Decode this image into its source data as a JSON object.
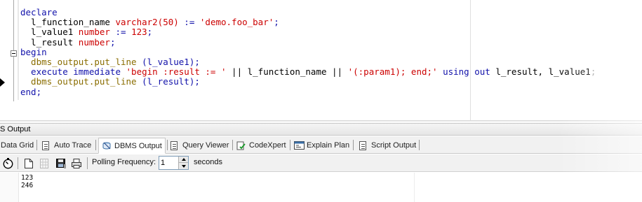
{
  "editor": {
    "lines": [
      [
        {
          "t": "declare",
          "c": "kw"
        }
      ],
      [
        {
          "t": "  l_function_name ",
          "c": "pl"
        },
        {
          "t": "varchar2(50)",
          "c": "ty"
        },
        {
          "t": " := ",
          "c": "kw"
        },
        {
          "t": "'demo.foo_bar'",
          "c": "st"
        },
        {
          "t": ";",
          "c": "kw"
        }
      ],
      [
        {
          "t": "  l_value1 ",
          "c": "pl"
        },
        {
          "t": "number",
          "c": "ty"
        },
        {
          "t": " := ",
          "c": "kw"
        },
        {
          "t": "123",
          "c": "st"
        },
        {
          "t": ";",
          "c": "kw"
        }
      ],
      [
        {
          "t": "  l_result ",
          "c": "pl"
        },
        {
          "t": "number",
          "c": "ty"
        },
        {
          "t": ";",
          "c": "kw"
        }
      ],
      [
        {
          "t": "begin",
          "c": "kw"
        }
      ],
      [
        {
          "t": "  dbms_output.put_line ",
          "c": "fn"
        },
        {
          "t": "(l_value1);",
          "c": "kw"
        }
      ],
      [
        {
          "t": "  execute immediate ",
          "c": "kw"
        },
        {
          "t": "'begin :result := '",
          "c": "st"
        },
        {
          "t": " || l_function_name || ",
          "c": "pl"
        },
        {
          "t": "'(:param1); end;'",
          "c": "st"
        },
        {
          "t": " using out ",
          "c": "kw"
        },
        {
          "t": "l_result, l_value1",
          "c": "pl"
        },
        {
          "t": ";",
          "c": "cm"
        }
      ],
      [
        {
          "t": "  dbms_output.put_line ",
          "c": "fn"
        },
        {
          "t": "(l_result);",
          "c": "kw"
        }
      ],
      [
        {
          "t": "end;",
          "c": "kw"
        }
      ]
    ]
  },
  "panel": {
    "title": "S Output"
  },
  "tabs": [
    {
      "label": "Data Grid",
      "icon": "grid-icon",
      "active": false
    },
    {
      "label": "Auto Trace",
      "icon": "page-icon",
      "active": false
    },
    {
      "label": "DBMS Output",
      "icon": "dbms-output-icon",
      "active": true
    },
    {
      "label": "Query Viewer",
      "icon": "page-icon",
      "active": false
    },
    {
      "label": "CodeXpert",
      "icon": "codexpert-icon",
      "active": false
    },
    {
      "label": "Explain Plan",
      "icon": "explain-plan-icon",
      "active": false
    },
    {
      "label": "Script Output",
      "icon": "page-icon",
      "active": false
    }
  ],
  "toolbar": {
    "polling_label": "Polling Frequency:",
    "polling_value": "1",
    "polling_unit": "seconds"
  },
  "output": {
    "text": "123\n246"
  },
  "colors": {
    "keyword": "#1111aa",
    "string": "#cc0000",
    "function": "#8a6d00",
    "panel_bg": "#f1f1f1"
  }
}
